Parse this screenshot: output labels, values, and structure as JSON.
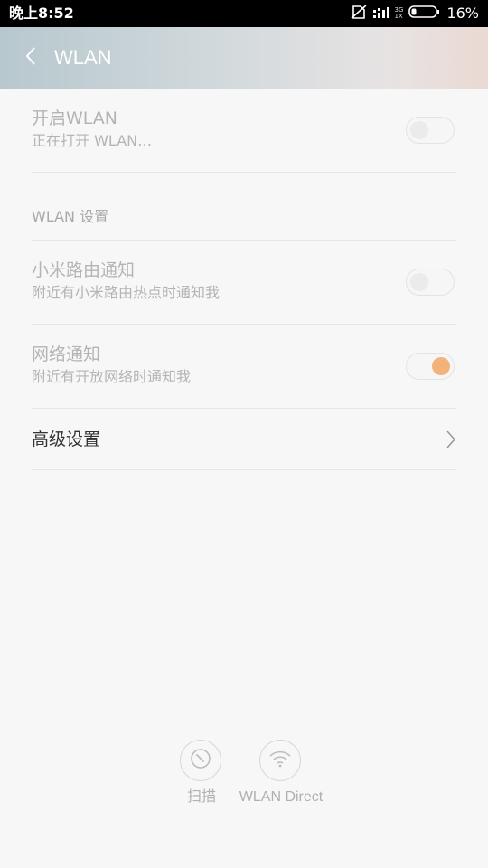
{
  "status_bar": {
    "time": "晚上8:52",
    "network_top": "3G",
    "network_bottom": "1X",
    "battery_percent": "16%"
  },
  "header": {
    "title": "WLAN",
    "back_icon": "chevron-left-icon"
  },
  "wlan_switch": {
    "title": "开启WLAN",
    "subtitle": "正在打开 WLAN…",
    "state": "off"
  },
  "section_header": "WLAN 设置",
  "settings": [
    {
      "title": "小米路由通知",
      "subtitle": "附近有小米路由热点时通知我",
      "state": "off"
    },
    {
      "title": "网络通知",
      "subtitle": "附近有开放网络时通知我",
      "state": "on"
    }
  ],
  "advanced": {
    "title": "高级设置",
    "icon": "chevron-right-icon"
  },
  "bottom_actions": [
    {
      "label": "扫描",
      "icon": "scan-icon"
    },
    {
      "label": "WLAN Direct",
      "icon": "wifi-icon"
    }
  ],
  "colors": {
    "toggle_on": "#f4b27b",
    "disabled_text": "#b4b4b4",
    "primary_text": "#333333"
  }
}
